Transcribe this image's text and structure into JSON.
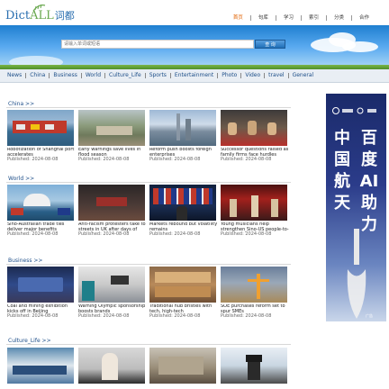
{
  "header": {
    "logo": {
      "part1": "Dict",
      "part2": "ALL",
      "part3": "词都"
    },
    "topnav": [
      "首页",
      "句库",
      "学习",
      "索引",
      "分类",
      "合作"
    ]
  },
  "search": {
    "placeholder": "请输入单词或短语",
    "button_label": "查 询"
  },
  "nav": [
    "News",
    "China",
    "Business",
    "World",
    "Culture_Life",
    "Sports",
    "Entertainment",
    "Photo",
    "Video",
    "travel",
    "General"
  ],
  "sections": [
    {
      "title": "China >>",
      "cards": [
        {
          "title": "Robotization of Shanghai port accelerates",
          "date": "Published: 2024-08-08"
        },
        {
          "title": "Early warnings save lives in flood season",
          "date": "Published: 2024-08-08"
        },
        {
          "title": "Reform push boosts foreign enterprises",
          "date": "Published: 2024-08-08"
        },
        {
          "title": "Successor questions raised as family firms face hurdles",
          "date": "Published: 2024-08-08"
        }
      ]
    },
    {
      "title": "World >>",
      "cards": [
        {
          "title": "Sino-Australian trade ties deliver major benefits",
          "date": "Published: 2024-08-08"
        },
        {
          "title": "Anti-racism protesters take to streets in UK after days of unrest",
          "date": "Published: 2024-08-08"
        },
        {
          "title": "Markets rebound but volatility remains",
          "date": "Published: 2024-08-08"
        },
        {
          "title": "Young musicians help strengthen Sino-US people-to-people exchanges",
          "date": "Published: 2024-08-08"
        }
      ]
    },
    {
      "title": "Business >>",
      "cards": [
        {
          "title": "Coal and mining exhibition kicks off in Beijing",
          "date": "Published: 2024-08-08"
        },
        {
          "title": "Warning Olympic sponsorship boosts brands",
          "date": "Published: 2024-08-08"
        },
        {
          "title": "Traditional hub bristles with tech, high-tech",
          "date": "Published: 2024-08-08"
        },
        {
          "title": "SOE purchases reform set to spur SMEs",
          "date": "Published: 2024-08-08"
        }
      ]
    },
    {
      "title": "Culture_Life >>",
      "cards": [
        {
          "title": "",
          "date": ""
        },
        {
          "title": "",
          "date": ""
        },
        {
          "title": "",
          "date": ""
        },
        {
          "title": "",
          "date": ""
        }
      ]
    }
  ],
  "ad": {
    "line1": "中国航天",
    "line2": "百度AI助力",
    "tag": "广告"
  },
  "colors": {
    "link": "#1d4e89",
    "accent": "#e06000",
    "banner_top": "#1f7fd0",
    "green_bar": "#6aa84f"
  }
}
